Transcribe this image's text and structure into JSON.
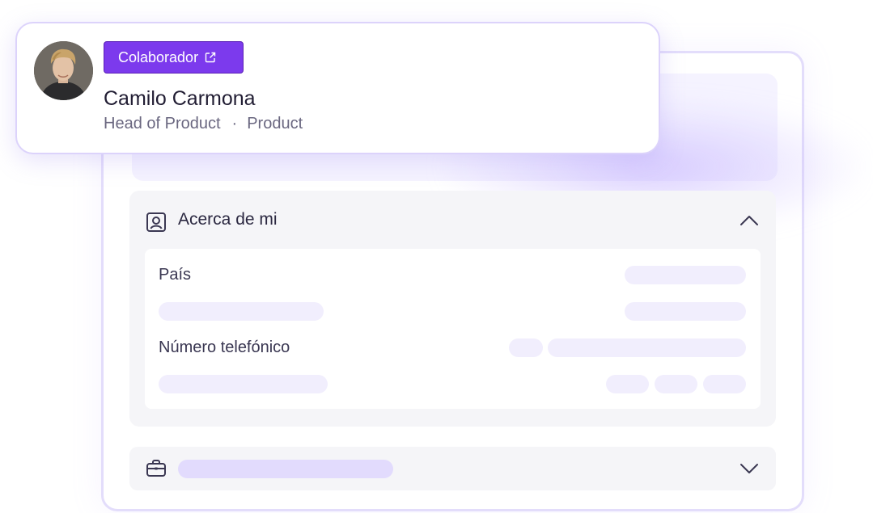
{
  "profile": {
    "role_badge": "Colaborador",
    "name": "Camilo Carmona",
    "job_title": "Head of Product",
    "separator": "·",
    "department": "Product"
  },
  "about_section": {
    "title": "Acerca de mi",
    "fields": {
      "country_label": "País",
      "phone_label": "Número telefónico"
    }
  },
  "colors": {
    "accent": "#7c3aed",
    "placeholder": "#f1eefd",
    "placeholder_strong": "#e2dbfd",
    "panel_border": "#e3ddfb"
  },
  "icons": {
    "external_link": "external-link-icon",
    "contact_card": "contact-card-icon",
    "chevron_up": "chevron-up-icon",
    "chevron_down": "chevron-down-icon",
    "briefcase": "briefcase-icon"
  }
}
